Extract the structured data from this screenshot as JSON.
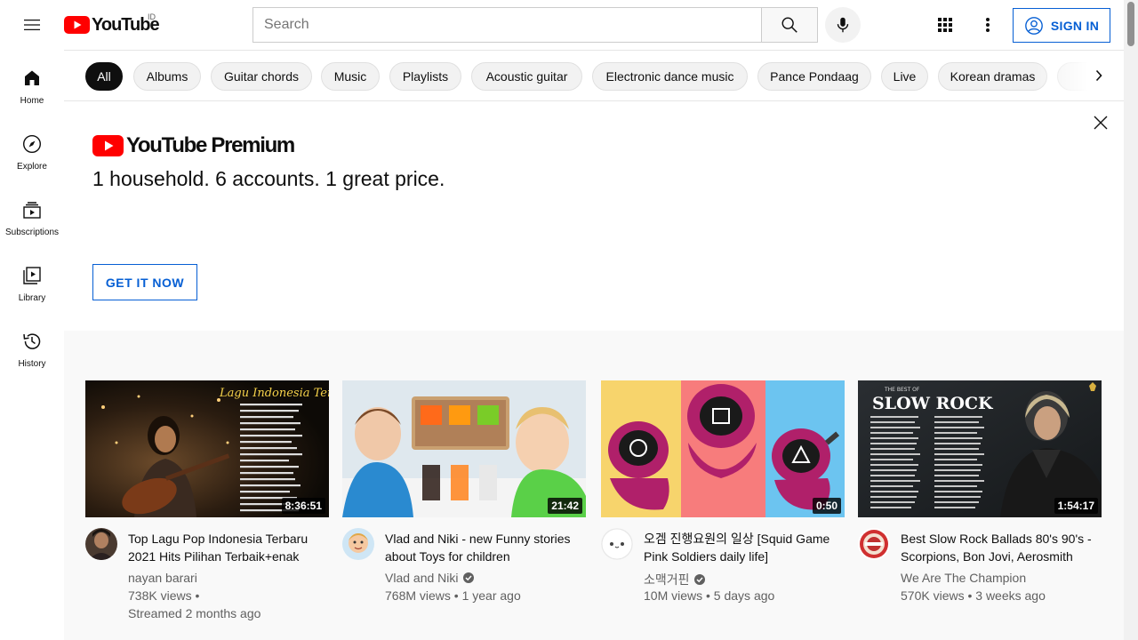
{
  "header": {
    "logo_text": "YouTube",
    "country_code": "ID",
    "search_placeholder": "Search",
    "signin_label": "SIGN IN"
  },
  "sidebar": {
    "items": [
      {
        "label": "Home",
        "icon": "home-icon"
      },
      {
        "label": "Explore",
        "icon": "compass-icon"
      },
      {
        "label": "Subscriptions",
        "icon": "subscriptions-icon"
      },
      {
        "label": "Library",
        "icon": "library-icon"
      },
      {
        "label": "History",
        "icon": "history-icon"
      }
    ]
  },
  "chips": [
    "All",
    "Albums",
    "Guitar chords",
    "Music",
    "Playlists",
    "Acoustic guitar",
    "Electronic dance music",
    "Pance Pondaag",
    "Live",
    "Korean dramas"
  ],
  "banner": {
    "logo_text": "YouTube Premium",
    "title": "1 household. 6 accounts. 1 great price.",
    "cta": "GET IT NOW"
  },
  "videos": [
    {
      "title": "Top Lagu Pop Indonesia Terbaru 2021 Hits Pilihan Terbaik+enak Didengar Waktu Kerja",
      "channel": "nayan barari",
      "verified": false,
      "stats": "738K views •",
      "extra": "Streamed 2 months ago",
      "duration": "8:36:51",
      "thumb_text": "Lagu Indonesia Terbaru"
    },
    {
      "title": "Vlad and Niki - new Funny stories about Toys for children",
      "channel": "Vlad and Niki",
      "verified": true,
      "stats": "768M views • 1 year ago",
      "extra": "",
      "duration": "21:42",
      "thumb_text": ""
    },
    {
      "title": "오겜 진행요원의 일상 [Squid Game Pink Soldiers daily life]",
      "channel": "소맥거핀",
      "verified": true,
      "stats": "10M views • 5 days ago",
      "extra": "",
      "duration": "0:50",
      "thumb_text": ""
    },
    {
      "title": "Best Slow Rock Ballads 80's 90's - Scorpions, Bon Jovi, Aerosmith",
      "channel": "We Are The Champion",
      "verified": false,
      "stats": "570K views • 3 weeks ago",
      "extra": "",
      "duration": "1:54:17",
      "thumb_text": "SLOW ROCK",
      "thumb_subtext": "THE BEST OF"
    }
  ],
  "colors": {
    "brand_red": "#ff0000",
    "link_blue": "#065fd4"
  }
}
